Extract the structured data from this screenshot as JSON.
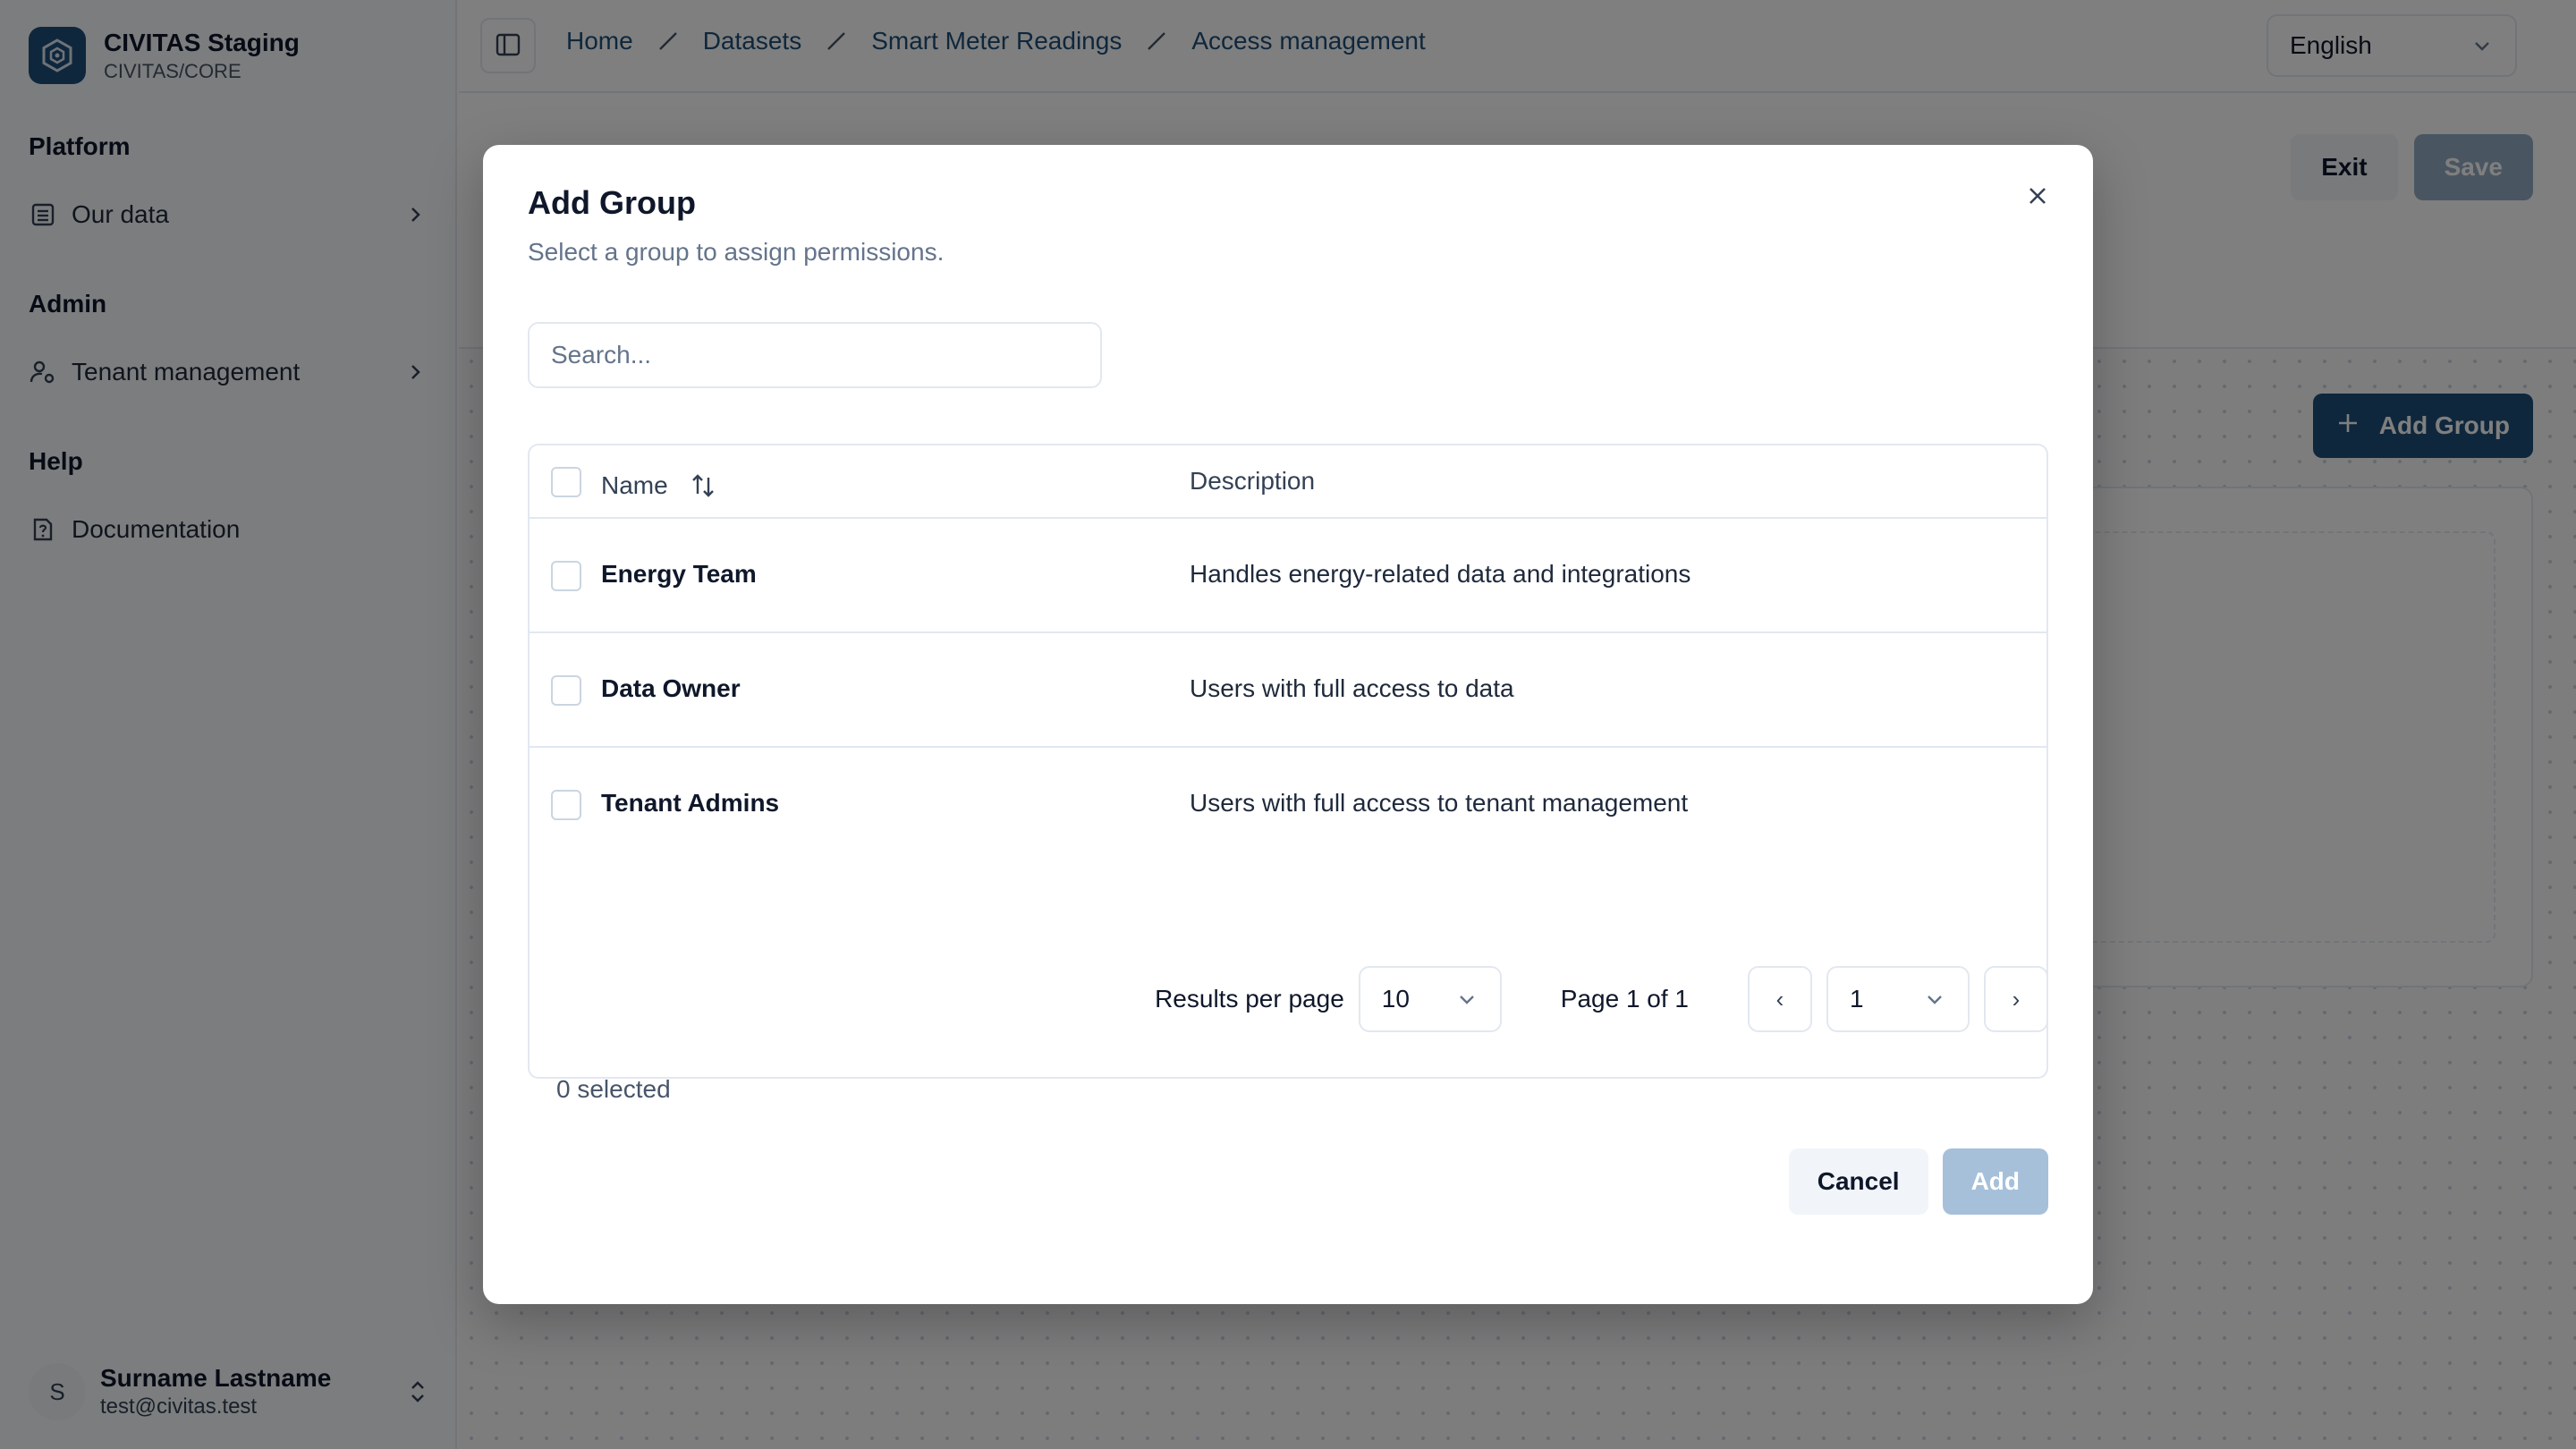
{
  "app": {
    "name": "CIVITAS Staging",
    "subtitle": "CIVITAS/CORE",
    "accent_color": "#1e4e79"
  },
  "sidebar": {
    "sections": [
      {
        "label": "Platform",
        "items": [
          {
            "label": "Our data",
            "icon": "database-list-icon"
          }
        ]
      },
      {
        "label": "Admin",
        "items": [
          {
            "label": "Tenant management",
            "icon": "user-cog-icon"
          }
        ]
      },
      {
        "label": "Help",
        "items": [
          {
            "label": "Documentation",
            "icon": "file-help-icon"
          }
        ]
      }
    ],
    "user": {
      "initial": "S",
      "name": "Surname Lastname",
      "email": "test@civitas.test"
    }
  },
  "topbar": {
    "breadcrumbs": [
      "Home",
      "Datasets",
      "Smart Meter Readings",
      "Access management"
    ],
    "language": "English"
  },
  "page": {
    "exit_label": "Exit",
    "save_label": "Save",
    "add_group_label": "Add Group"
  },
  "modal": {
    "title": "Add Group",
    "description": "Select a group to assign permissions.",
    "search_placeholder": "Search...",
    "columns": {
      "name": "Name",
      "description": "Description"
    },
    "rows": [
      {
        "name": "Energy Team",
        "description": "Handles energy-related data and integrations"
      },
      {
        "name": "Data Owner",
        "description": "Users with full access to data"
      },
      {
        "name": "Tenant Admins",
        "description": "Users with full access to tenant management"
      }
    ],
    "pagination": {
      "results_label": "Results per page",
      "page_size": "10",
      "page_of": "Page 1 of 1",
      "current_page": "1",
      "prev": "‹",
      "next": "›"
    },
    "selected_count": "0 selected",
    "cancel_label": "Cancel",
    "add_label": "Add"
  }
}
